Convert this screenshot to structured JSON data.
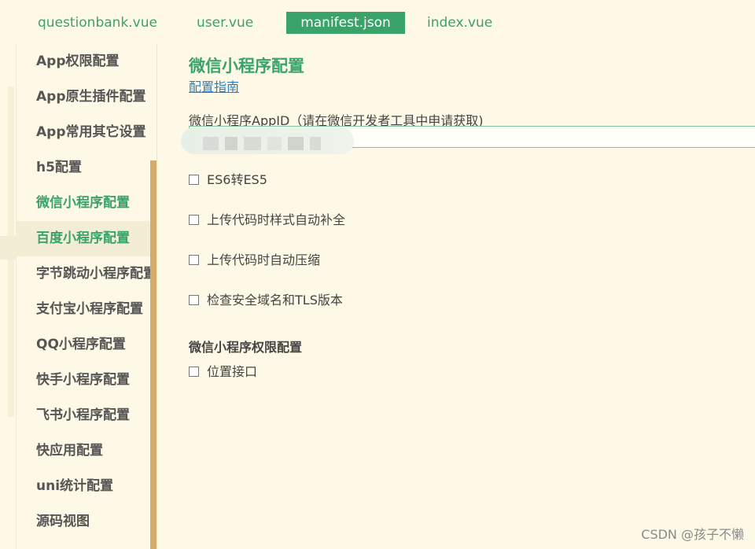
{
  "tabs": [
    {
      "label": "questionbank.vue",
      "active": false
    },
    {
      "label": "user.vue",
      "active": false
    },
    {
      "label": "manifest.json",
      "active": true
    },
    {
      "label": "index.vue",
      "active": false
    }
  ],
  "sidebar": {
    "items": [
      {
        "label": "App权限配置"
      },
      {
        "label": "App原生插件配置"
      },
      {
        "label": "App常用其它设置"
      },
      {
        "label": "h5配置"
      },
      {
        "label": "微信小程序配置",
        "state": "active"
      },
      {
        "label": "百度小程序配置",
        "state": "hovered"
      },
      {
        "label": "字节跳动小程序配置"
      },
      {
        "label": "支付宝小程序配置"
      },
      {
        "label": "QQ小程序配置"
      },
      {
        "label": "快手小程序配置"
      },
      {
        "label": "飞书小程序配置"
      },
      {
        "label": "快应用配置"
      },
      {
        "label": "uni统计配置"
      },
      {
        "label": "源码视图"
      }
    ]
  },
  "main": {
    "title": "微信小程序配置",
    "guide_link": "配置指南",
    "appid_label": "微信小程序AppID（请在微信开发者工具中申请获取)",
    "appid_value": "",
    "options": [
      {
        "label": "ES6转ES5",
        "checked": false
      },
      {
        "label": "上传代码时样式自动补全",
        "checked": false
      },
      {
        "label": "上传代码时自动压缩",
        "checked": false
      },
      {
        "label": "检查安全域名和TLS版本",
        "checked": false
      }
    ],
    "permissions_title": "微信小程序权限配置",
    "permissions": [
      {
        "label": "位置接口",
        "checked": false
      }
    ]
  },
  "watermark": "CSDN @孩子不懒",
  "colors": {
    "accent": "#3aa36a",
    "background": "#fdf9e6",
    "scrollbar": "#d3ad6a",
    "link": "#2f7fc0"
  }
}
